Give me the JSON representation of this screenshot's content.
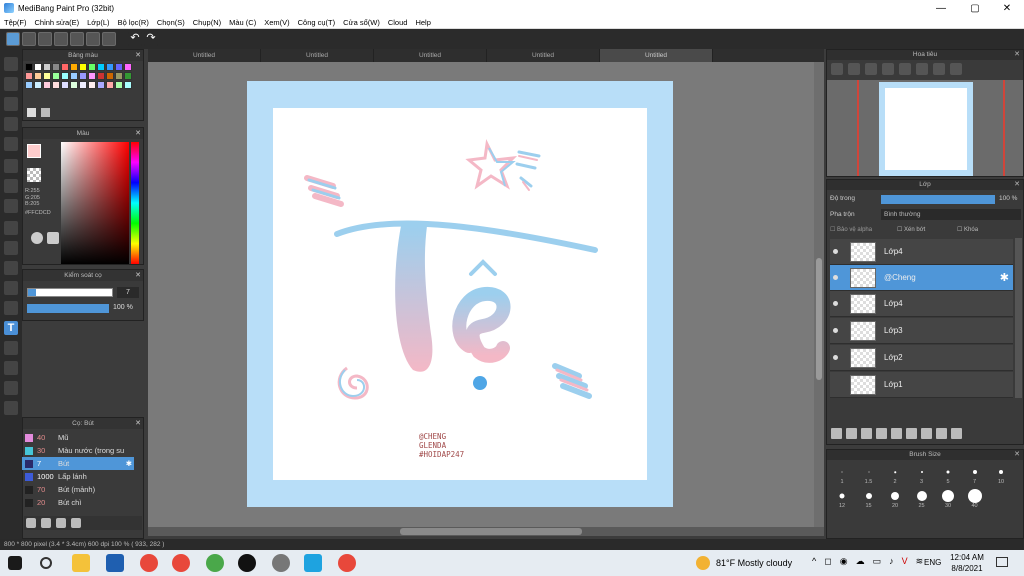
{
  "window": {
    "title": "MediBang Paint Pro (32bit)",
    "controls": [
      "—",
      "▢",
      "✕"
    ]
  },
  "menu": [
    "Tệp(F)",
    "Chỉnh sửa(E)",
    "Lớp(L)",
    "Bộ lọc(R)",
    "Chọn(S)",
    "Chụp(N)",
    "Màu (C)",
    "Xem(V)",
    "Công cụ(T)",
    "Cửa sổ(W)",
    "Cloud",
    "Help"
  ],
  "tabs": [
    "Untitled",
    "Untitled",
    "Untitled",
    "Untitled",
    "Untitled"
  ],
  "panels": {
    "palette_title": "Bảng màu",
    "color_title": "Màu",
    "color_values": {
      "r": "R:255",
      "g": "G:205",
      "b": "B:205",
      "hex": "#FFCDCD"
    },
    "brush_control_title": "Kiểm soát cọ",
    "brush_size": "7",
    "brush_opacity": "100 %",
    "brush_list_title": "Cọ: Bút",
    "navigator_title": "Hoa tiêu",
    "layer_title": "Lớp",
    "opacity_label": "Độ trong",
    "opacity_value": "100 %",
    "blend_label": "Pha trộn",
    "blend_value": "Bình thường",
    "protect_alpha": "Bảo vệ alpha",
    "clipping": "Xén bớt",
    "lock": "Khóa",
    "brush_size_title": "Brush Size"
  },
  "brushes": [
    {
      "size": "40",
      "name": "Mũ",
      "color": "#e38bdc"
    },
    {
      "size": "30",
      "name": "Màu nước (trong su",
      "color": "#46c6d8"
    },
    {
      "size": "7",
      "name": "Bút",
      "color": "#2a2a6a"
    },
    {
      "size": "1000",
      "name": "Lấp lánh",
      "color": "#3d5bd8"
    },
    {
      "size": "70",
      "name": "Bút (mảnh)",
      "color": "#222222"
    },
    {
      "size": "20",
      "name": "Bút chì",
      "color": "#222222"
    }
  ],
  "layers": [
    {
      "name": "Lớp4",
      "selected": false,
      "visible": true
    },
    {
      "name": "@Cheng",
      "selected": true,
      "visible": true
    },
    {
      "name": "Lớp4",
      "selected": false,
      "visible": true
    },
    {
      "name": "Lớp3",
      "selected": false,
      "visible": true
    },
    {
      "name": "Lớp2",
      "selected": false,
      "visible": true
    },
    {
      "name": "Lớp1",
      "selected": false,
      "visible": false
    }
  ],
  "brush_sizes": [
    "1",
    "1.5",
    "2",
    "3",
    "5",
    "7",
    "10",
    "12",
    "15",
    "20",
    "25",
    "30",
    "40"
  ],
  "artwork": {
    "letter": "Tệ",
    "credit_line1": "@CHENG",
    "credit_line2": "GLENDA",
    "credit_line3": "#HOIDAP247"
  },
  "status": "800 * 800 pixel  (3.4 * 3.4cm)  600 dpi  100 %  ( 933, 282 )",
  "taskbar": {
    "weather": "81°F  Mostly cloudy",
    "lang": "ENG",
    "time": "12:04 AM",
    "date": "8/8/2021"
  },
  "colors": {
    "accent": "#4f96d8",
    "canvas_border": "#b8def8",
    "pink": "#f4b8c6",
    "blue": "#9ccfee"
  }
}
